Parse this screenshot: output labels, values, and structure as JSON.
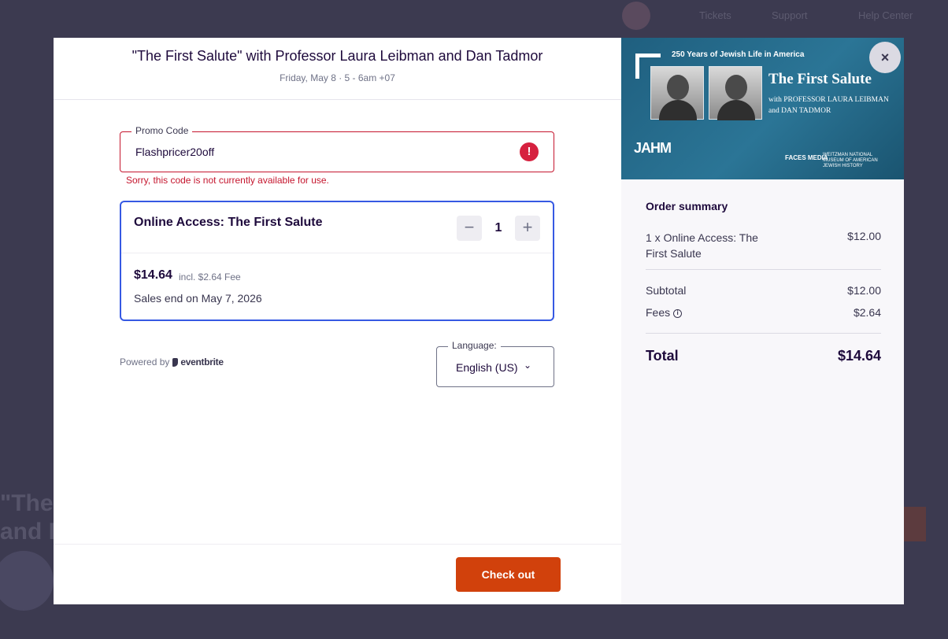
{
  "backdrop": {
    "links": [
      "Tickets",
      "Support",
      "Help Center"
    ],
    "heading_line1": "\"The",
    "heading_line2": "and I"
  },
  "event": {
    "title": "\"The First Salute\" with Professor Laura Leibman and Dan Tadmor",
    "date": "Friday, May 8 · 5 - 6am +07"
  },
  "promo": {
    "label": "Promo Code",
    "value": "Flashpricer20off",
    "error_icon": "!",
    "error": "Sorry, this code is not currently available for use."
  },
  "ticket": {
    "name": "Online Access: The First Salute",
    "decrement_label": "−",
    "quantity": "1",
    "increment_label": "+",
    "price": "$14.64",
    "fee_note": "incl. $2.64 Fee",
    "sales_end": "Sales end on May 7, 2026"
  },
  "footer": {
    "powered_by": "Powered by",
    "brand": "eventbrite",
    "language_label": "Language:",
    "language_value": "English (US)",
    "chevron": "⌄",
    "checkout_label": "Check out"
  },
  "banner": {
    "tagline": "250 Years of Jewish Life in America",
    "title": "The First Salute",
    "subtitle": "with PROFESSOR LAURA LEIBMAN and DAN TADMOR",
    "logo_jahm": "JAHM",
    "logo_faces": "FACES MEDIA",
    "logo_museum": "WEITZMAN NATIONAL MUSEUM OF AMERICAN JEWISH HISTORY",
    "close_label": "×"
  },
  "summary": {
    "heading": "Order summary",
    "item_label": "1 x Online Access: The First Salute",
    "item_price": "$12.00",
    "subtotal_label": "Subtotal",
    "subtotal_value": "$12.00",
    "fees_label": "Fees",
    "fees_info_icon": "i",
    "fees_value": "$2.64",
    "total_label": "Total",
    "total_value": "$14.64"
  },
  "colors": {
    "primary_cta": "#d1410c",
    "error": "#c5162e",
    "selected_border": "#3659e3",
    "backdrop": "#3c3a50"
  },
  "icons": [
    "alert-icon",
    "minus-icon",
    "plus-icon",
    "chevron-down-icon",
    "info-icon",
    "close-icon",
    "eventbrite-logo-icon"
  ]
}
